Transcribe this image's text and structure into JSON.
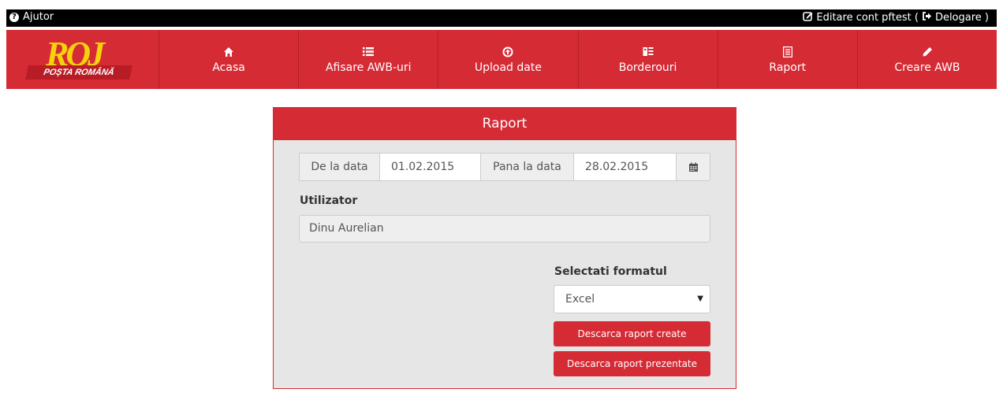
{
  "topbar": {
    "help_label": "Ajutor",
    "edit_account": "Editare cont",
    "username_prefix": "pftest (",
    "logout_label": "Delogare )"
  },
  "logo": {
    "mark": "ROJ",
    "tagline": "POȘTA ROMÂNĂ"
  },
  "nav": {
    "items": [
      {
        "label": "Acasa",
        "icon": "home-icon"
      },
      {
        "label": "Afisare AWB-uri",
        "icon": "list-icon"
      },
      {
        "label": "Upload date",
        "icon": "upload-circle-icon"
      },
      {
        "label": "Borderouri",
        "icon": "batch-icon"
      },
      {
        "label": "Raport",
        "icon": "report-icon"
      },
      {
        "label": "Creare AWB",
        "icon": "pencil-icon"
      }
    ]
  },
  "panel": {
    "title": "Raport",
    "from_label": "De la data",
    "from_value": "01.02.2015",
    "to_label": "Pana la data",
    "to_value": "28.02.2015",
    "user_label": "Utilizator",
    "user_value": "Dinu Aurelian",
    "format_label": "Selectati formatul",
    "format_selected": "Excel",
    "btn_created": "Descarca raport create",
    "btn_presented": "Descarca raport prezentate"
  },
  "colors": {
    "brand_red": "#d52b35",
    "logo_yellow": "#f5d20c",
    "topbar_black": "#000000"
  }
}
